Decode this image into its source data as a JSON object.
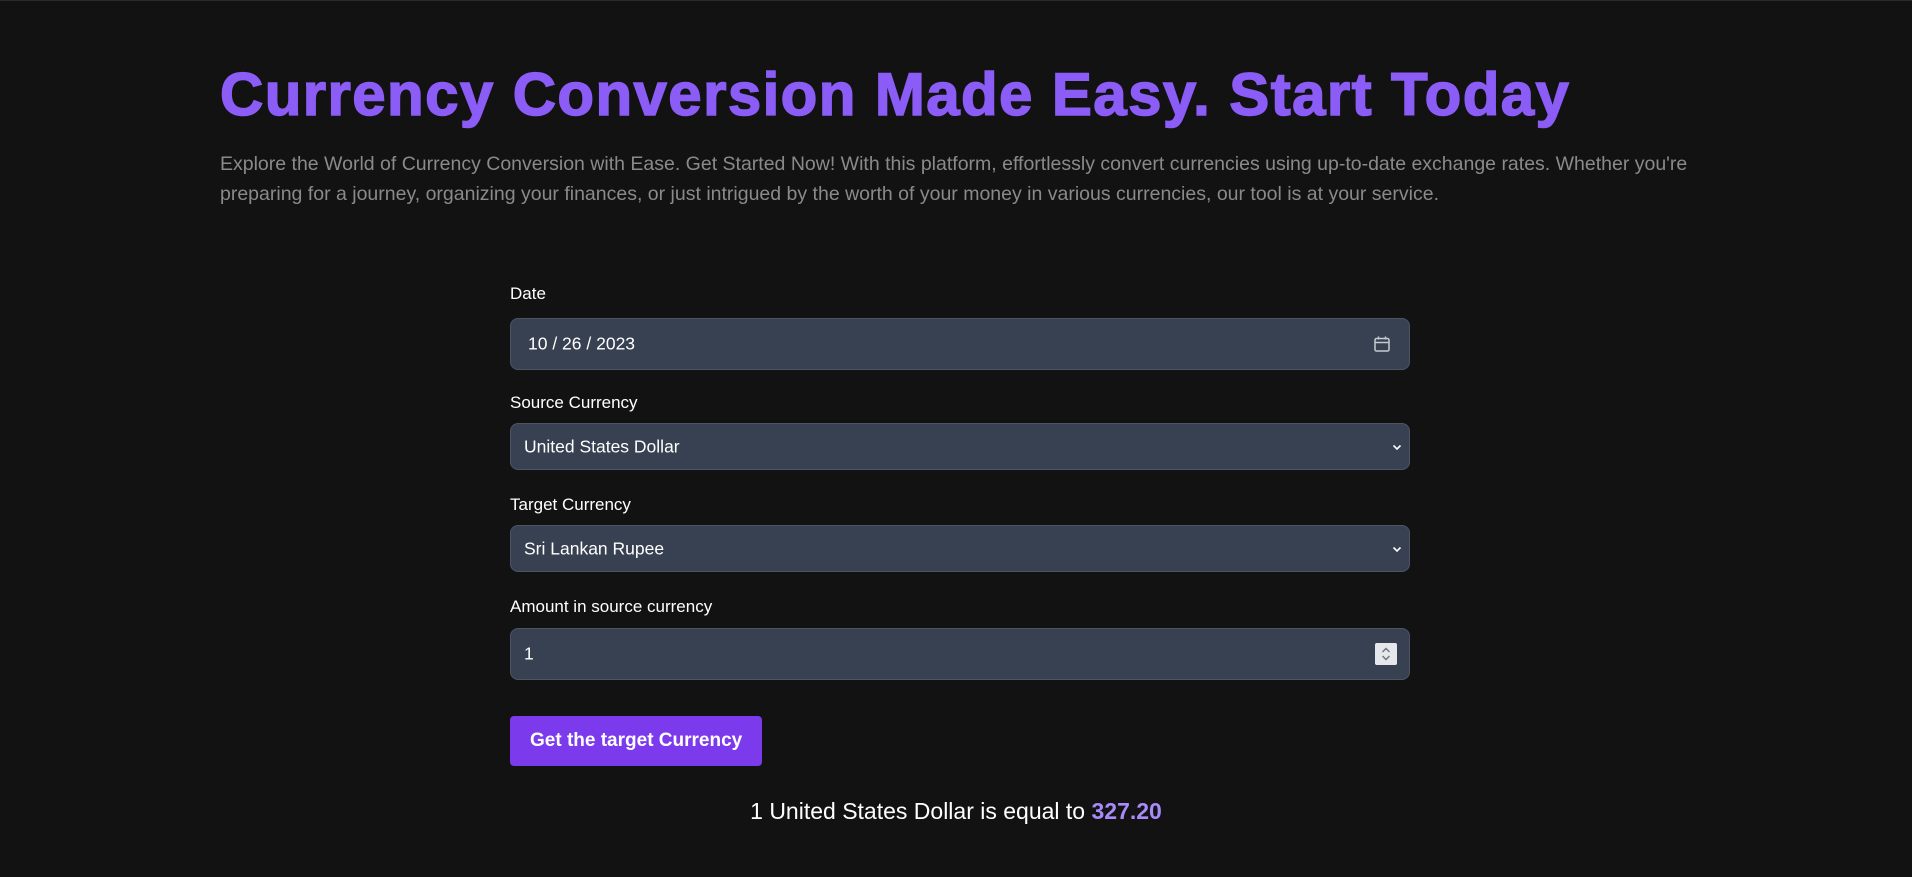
{
  "hero": {
    "title": "Currency Conversion Made Easy. Start Today",
    "description": "Explore the World of Currency Conversion with Ease. Get Started Now! With this platform, effortlessly convert currencies using up-to-date exchange rates. Whether you're preparing for a journey, organizing your finances, or just intrigued by the worth of your money in various currencies, our tool is at your service."
  },
  "form": {
    "date": {
      "label": "Date",
      "value": "10 / 26 / 2023",
      "icon": "calendar-icon"
    },
    "source_currency": {
      "label": "Source Currency",
      "value": "United States Dollar",
      "icon": "chevron-down-icon"
    },
    "target_currency": {
      "label": "Target Currency",
      "value": "Sri Lankan Rupee",
      "icon": "chevron-down-icon"
    },
    "amount": {
      "label": "Amount in source currency",
      "value": "1",
      "icon": "spinner-icon"
    },
    "submit_label": "Get the target Currency"
  },
  "result": {
    "prefix": "1 United States Dollar is equal to",
    "amount": "327.20"
  },
  "colors": {
    "background": "#121212",
    "accent": "#8b5cf6",
    "button": "#7c3aed",
    "field_bg": "#374151",
    "result_amount": "#a78bfa"
  }
}
